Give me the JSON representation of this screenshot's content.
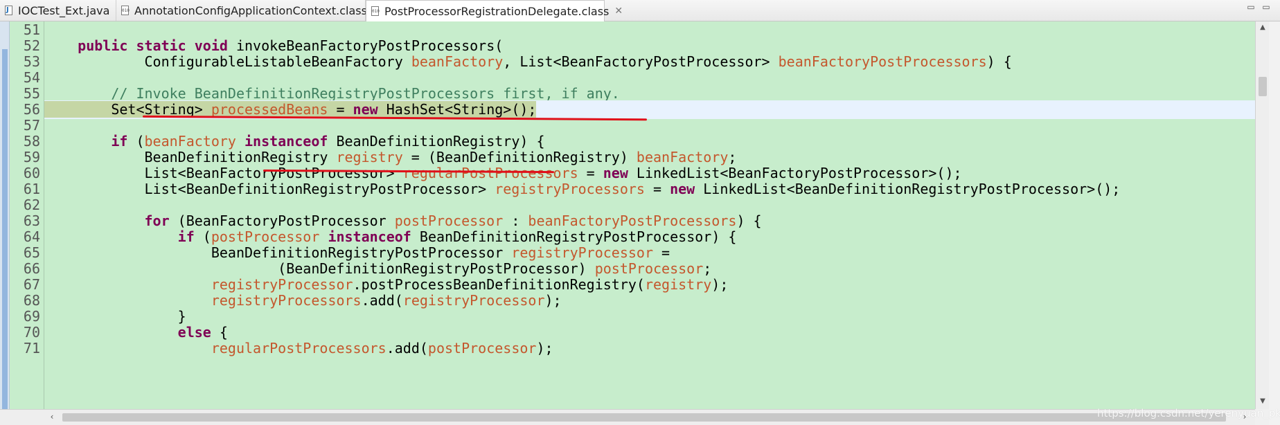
{
  "tabs": [
    {
      "label": "IOCTest_Ext.java",
      "icon": "java-file-icon"
    },
    {
      "label": "AnnotationConfigApplicationContext.class",
      "icon": "class-file-icon"
    },
    {
      "label": "PostProcessorRegistrationDelegate.class",
      "icon": "class-file-icon",
      "active": true,
      "close": "✕"
    }
  ],
  "window_controls": {
    "minimize": "▭",
    "maximize": "▭"
  },
  "editor": {
    "lines": [
      {
        "no": "51",
        "segments": []
      },
      {
        "no": "52",
        "segments": [
          {
            "t": "    "
          },
          {
            "t": "public",
            "c": "kw"
          },
          {
            "t": " "
          },
          {
            "t": "static",
            "c": "kw"
          },
          {
            "t": " "
          },
          {
            "t": "void",
            "c": "kw"
          },
          {
            "t": " invokeBeanFactoryPostProcessors("
          }
        ]
      },
      {
        "no": "53",
        "segments": [
          {
            "t": "            ConfigurableListableBeanFactory "
          },
          {
            "t": "beanFactory",
            "c": "fld"
          },
          {
            "t": ", List<BeanFactoryPostProcessor> "
          },
          {
            "t": "beanFactoryPostProcessors",
            "c": "fld"
          },
          {
            "t": ") {"
          }
        ]
      },
      {
        "no": "54",
        "segments": []
      },
      {
        "no": "55",
        "segments": [
          {
            "t": "        "
          },
          {
            "t": "// Invoke BeanDefinitionRegistryPostProcessors first, if any.",
            "c": "cmt"
          }
        ]
      },
      {
        "no": "56",
        "current": true,
        "segments": [
          {
            "t": "        Set<String> ",
            "c": "selhl"
          },
          {
            "t": "processedBeans",
            "c": "fld selhl"
          },
          {
            "t": " = ",
            "c": "selhl"
          },
          {
            "t": "new",
            "c": "kw selhl"
          },
          {
            "t": " HashSet<String>();",
            "c": "selhl"
          }
        ]
      },
      {
        "no": "57",
        "segments": []
      },
      {
        "no": "58",
        "segments": [
          {
            "t": "        "
          },
          {
            "t": "if",
            "c": "kw"
          },
          {
            "t": " ("
          },
          {
            "t": "beanFactory",
            "c": "fld"
          },
          {
            "t": " "
          },
          {
            "t": "instanceof",
            "c": "kw"
          },
          {
            "t": " BeanDefinitionRegistry) {"
          }
        ]
      },
      {
        "no": "59",
        "segments": [
          {
            "t": "            BeanDefinitionRegistry "
          },
          {
            "t": "registry",
            "c": "fld"
          },
          {
            "t": " = (BeanDefinitionRegistry) "
          },
          {
            "t": "beanFactory",
            "c": "fld"
          },
          {
            "t": ";"
          }
        ]
      },
      {
        "no": "60",
        "segments": [
          {
            "t": "            List<BeanFactoryPostProcessor> "
          },
          {
            "t": "regularPostProcessors",
            "c": "fld"
          },
          {
            "t": " = "
          },
          {
            "t": "new",
            "c": "kw"
          },
          {
            "t": " LinkedList<BeanFactoryPostProcessor>();"
          }
        ]
      },
      {
        "no": "61",
        "segments": [
          {
            "t": "            List<BeanDefinitionRegistryPostProcessor> "
          },
          {
            "t": "registryProcessors",
            "c": "fld"
          },
          {
            "t": " = "
          },
          {
            "t": "new",
            "c": "kw"
          },
          {
            "t": " LinkedList<BeanDefinitionRegistryPostProcessor>();"
          }
        ]
      },
      {
        "no": "62",
        "segments": []
      },
      {
        "no": "63",
        "segments": [
          {
            "t": "            "
          },
          {
            "t": "for",
            "c": "kw"
          },
          {
            "t": " (BeanFactoryPostProcessor "
          },
          {
            "t": "postProcessor",
            "c": "fld"
          },
          {
            "t": " : "
          },
          {
            "t": "beanFactoryPostProcessors",
            "c": "fld"
          },
          {
            "t": ") {"
          }
        ]
      },
      {
        "no": "64",
        "segments": [
          {
            "t": "                "
          },
          {
            "t": "if",
            "c": "kw"
          },
          {
            "t": " ("
          },
          {
            "t": "postProcessor",
            "c": "fld"
          },
          {
            "t": " "
          },
          {
            "t": "instanceof",
            "c": "kw"
          },
          {
            "t": " BeanDefinitionRegistryPostProcessor) {"
          }
        ]
      },
      {
        "no": "65",
        "segments": [
          {
            "t": "                    BeanDefinitionRegistryPostProcessor "
          },
          {
            "t": "registryProcessor",
            "c": "fld"
          },
          {
            "t": " ="
          }
        ]
      },
      {
        "no": "66",
        "segments": [
          {
            "t": "                            (BeanDefinitionRegistryPostProcessor) "
          },
          {
            "t": "postProcessor",
            "c": "fld"
          },
          {
            "t": ";"
          }
        ]
      },
      {
        "no": "67",
        "segments": [
          {
            "t": "                    "
          },
          {
            "t": "registryProcessor",
            "c": "fld"
          },
          {
            "t": ".postProcessBeanDefinitionRegistry("
          },
          {
            "t": "registry",
            "c": "fld"
          },
          {
            "t": ");"
          }
        ]
      },
      {
        "no": "68",
        "segments": [
          {
            "t": "                    "
          },
          {
            "t": "registryProcessors",
            "c": "fld"
          },
          {
            "t": ".add("
          },
          {
            "t": "registryProcessor",
            "c": "fld"
          },
          {
            "t": ");"
          }
        ]
      },
      {
        "no": "69",
        "segments": [
          {
            "t": "                }"
          }
        ]
      },
      {
        "no": "70",
        "segments": [
          {
            "t": "                "
          },
          {
            "t": "else",
            "c": "kw"
          },
          {
            "t": " {"
          }
        ]
      },
      {
        "no": "71",
        "segments": [
          {
            "t": "                    "
          },
          {
            "t": "regularPostProcessors",
            "c": "fld"
          },
          {
            "t": ".add("
          },
          {
            "t": "postProcessor",
            "c": "fld"
          },
          {
            "t": ");"
          }
        ]
      }
    ]
  },
  "colors": {
    "editor_bg": "#c7edcc",
    "keyword": "#7f0055",
    "field": "#c4572d",
    "comment": "#3f7f5f",
    "current_line": "#e8f2fe",
    "annotation_red": "#e0101a"
  },
  "watermark": "https://blog.csdn.net/yerenyuan_pku"
}
